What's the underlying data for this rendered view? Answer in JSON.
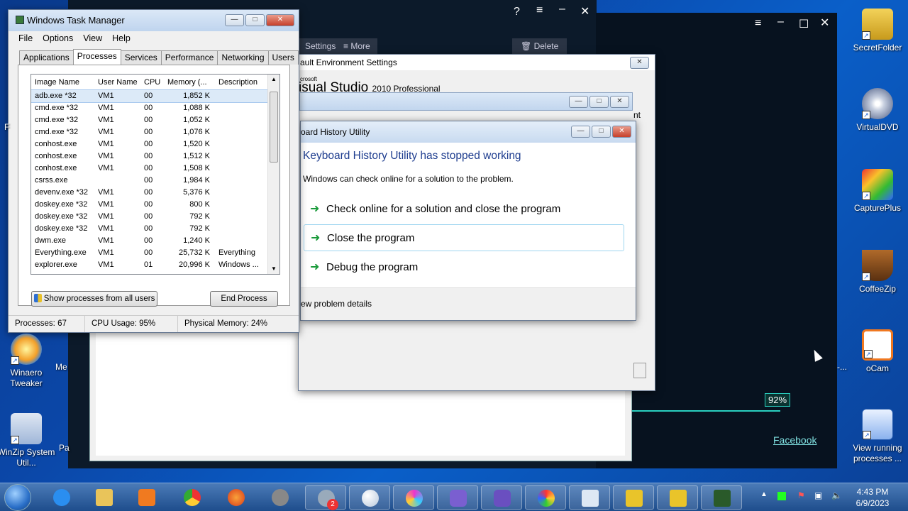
{
  "desktop": {
    "right_icons": [
      {
        "label": "SecretFolder"
      },
      {
        "label": "VirtualDVD"
      },
      {
        "label": "CapturePlus"
      },
      {
        "label": "CoffeeZip"
      },
      {
        "label": "oCam"
      },
      {
        "label": "View running processes ..."
      }
    ],
    "left_icons": [
      {
        "label": "Winaero Tweaker"
      },
      {
        "label": "WinZip System Util..."
      }
    ],
    "partial_labels": {
      "me": "Me",
      "pa": "Pa",
      "f": "F",
      "tail": "-..."
    }
  },
  "media": {
    "progress_label": "92%",
    "progress": 0.92,
    "facebook_link": "Facebook",
    "toolbar": {
      "settings": "Settings",
      "more": "More",
      "delete": "Delete"
    }
  },
  "vs_window": {
    "title": "ault Environment Settings",
    "brand_small": "crosoft",
    "brand": "isual Studio",
    "brand_suffix": "2010 Professional",
    "side_text": "nt"
  },
  "task_manager": {
    "title": "Windows Task Manager",
    "menu": [
      "File",
      "Options",
      "View",
      "Help"
    ],
    "tabs": [
      "Applications",
      "Processes",
      "Services",
      "Performance",
      "Networking",
      "Users"
    ],
    "active_tab": "Processes",
    "columns": [
      "Image Name",
      "User Name",
      "CPU",
      "Memory (...",
      "Description"
    ],
    "rows": [
      [
        "adb.exe *32",
        "VM1",
        "00",
        "1,852 K",
        ""
      ],
      [
        "cmd.exe *32",
        "VM1",
        "00",
        "1,088 K",
        ""
      ],
      [
        "cmd.exe *32",
        "VM1",
        "00",
        "1,052 K",
        ""
      ],
      [
        "cmd.exe *32",
        "VM1",
        "00",
        "1,076 K",
        ""
      ],
      [
        "conhost.exe",
        "VM1",
        "00",
        "1,520 K",
        ""
      ],
      [
        "conhost.exe",
        "VM1",
        "00",
        "1,512 K",
        ""
      ],
      [
        "conhost.exe",
        "VM1",
        "00",
        "1,508 K",
        ""
      ],
      [
        "csrss.exe",
        "",
        "00",
        "1,984 K",
        ""
      ],
      [
        "devenv.exe *32",
        "VM1",
        "00",
        "5,376 K",
        ""
      ],
      [
        "doskey.exe *32",
        "VM1",
        "00",
        "800 K",
        ""
      ],
      [
        "doskey.exe *32",
        "VM1",
        "00",
        "792 K",
        ""
      ],
      [
        "doskey.exe *32",
        "VM1",
        "00",
        "792 K",
        ""
      ],
      [
        "dwm.exe",
        "VM1",
        "00",
        "1,240 K",
        ""
      ],
      [
        "Everything.exe",
        "VM1",
        "00",
        "25,732 K",
        "Everything"
      ],
      [
        "explorer.exe",
        "VM1",
        "01",
        "20,996 K",
        "Windows ..."
      ]
    ],
    "show_all_button": "Show processes from all users",
    "end_process_button": "End Process",
    "status": {
      "processes": "Processes: 67",
      "cpu": "CPU Usage: 95%",
      "memory": "Physical Memory: 24%"
    }
  },
  "error_dialog": {
    "title": "oard History Utility",
    "heading": "Keyboard History Utility has stopped working",
    "subtext": "Windows can check online for a solution to the problem.",
    "options": [
      "Check online for a solution and close the program",
      "Close the program",
      "Debug the program"
    ],
    "details": "ew problem details"
  },
  "taskbar": {
    "time": "4:43 PM",
    "date": "6/9/2023",
    "badge": "2"
  },
  "colors": {
    "accent": "#1e3d8f",
    "link": "#7fe0e0",
    "progress": "#2ad0c0"
  }
}
